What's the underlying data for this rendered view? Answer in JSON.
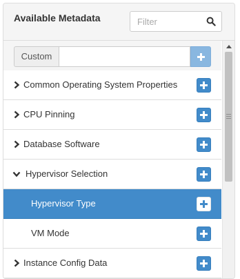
{
  "panel": {
    "title": "Available Metadata"
  },
  "filter": {
    "placeholder": "Filter",
    "icon": "search-icon"
  },
  "custom": {
    "addon_label": "Custom",
    "value": ""
  },
  "items": [
    {
      "label": "Common Operating System Properties",
      "expanded": false,
      "selected": false
    },
    {
      "label": "CPU Pinning",
      "expanded": false,
      "selected": false
    },
    {
      "label": "Database Software",
      "expanded": false,
      "selected": false
    },
    {
      "label": "Hypervisor Selection",
      "expanded": true,
      "selected": false
    },
    {
      "label": "Hypervisor Type",
      "child": true,
      "selected": true
    },
    {
      "label": "VM Mode",
      "child": true,
      "selected": false
    },
    {
      "label": "Instance Config Data",
      "expanded": false,
      "selected": false
    }
  ],
  "colors": {
    "accent": "#428bca",
    "accent_disabled": "#89b7e0",
    "header_bg": "#f5f5f5",
    "border": "#dddddd"
  }
}
